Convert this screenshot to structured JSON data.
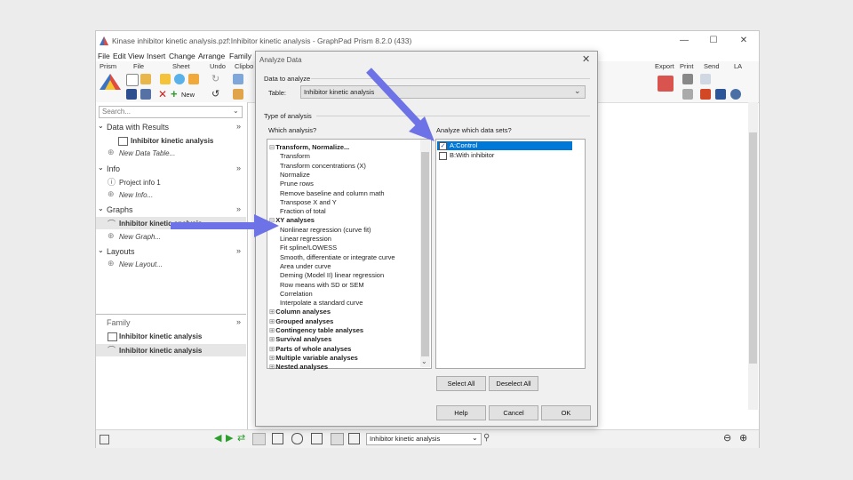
{
  "window": {
    "title": "Kinase inhibitor kinetic analysis.pzf:Inhibitor kinetic analysis - GraphPad Prism 8.2.0 (433)",
    "controls": [
      "—",
      "☐",
      "✕"
    ]
  },
  "menu": [
    "File",
    "Edit",
    "View",
    "Insert",
    "Change",
    "Arrange",
    "Family"
  ],
  "ribbon": {
    "groups_left": [
      "Prism",
      "File",
      "Sheet",
      "Undo",
      "Clipbo"
    ],
    "groups_right": [
      "Export",
      "Print",
      "Send",
      "LA"
    ],
    "new_label": "New"
  },
  "nav": {
    "search_placeholder": "Search...",
    "data_with_results": "Data with Results",
    "data_item": "Inhibitor kinetic analysis",
    "new_data_table": "New Data Table...",
    "info": "Info",
    "project_info": "Project info 1",
    "new_info": "New Info...",
    "graphs": "Graphs",
    "graph_item": "Inhibitor kinetic analysis",
    "new_graph": "New Graph...",
    "layouts": "Layouts",
    "new_layout": "New Layout...",
    "family": "Family",
    "family_items": [
      "Inhibitor kinetic analysis",
      "Inhibitor kinetic analysis"
    ]
  },
  "status": {
    "sheet_select": "Inhibitor kinetic analysis"
  },
  "dialog": {
    "title": "Analyze Data",
    "data_to_analyze": "Data to analyze",
    "table_label": "Table:",
    "table_value": "Inhibitor kinetic analysis",
    "type_of_analysis": "Type of analysis",
    "which_analysis": "Which analysis?",
    "analyze_which": "Analyze which data sets?",
    "analyses": [
      {
        "text": "Transform, Normalize...",
        "group": true,
        "open": true
      },
      {
        "text": "Transform"
      },
      {
        "text": "Transform concentrations (X)"
      },
      {
        "text": "Normalize"
      },
      {
        "text": "Prune rows"
      },
      {
        "text": "Remove baseline and column math"
      },
      {
        "text": "Transpose X and Y"
      },
      {
        "text": "Fraction of total"
      },
      {
        "text": "XY analyses",
        "group": true,
        "open": true
      },
      {
        "text": "Nonlinear regression (curve fit)"
      },
      {
        "text": "Linear regression"
      },
      {
        "text": "Fit spline/LOWESS"
      },
      {
        "text": "Smooth, differentiate or integrate curve"
      },
      {
        "text": "Area under curve"
      },
      {
        "text": "Deming (Model II) linear regression"
      },
      {
        "text": "Row means with SD or SEM"
      },
      {
        "text": "Correlation"
      },
      {
        "text": "Interpolate a standard curve"
      },
      {
        "text": "Column analyses",
        "group": true
      },
      {
        "text": "Grouped analyses",
        "group": true
      },
      {
        "text": "Contingency table analyses",
        "group": true
      },
      {
        "text": "Survival analyses",
        "group": true
      },
      {
        "text": "Parts of whole analyses",
        "group": true
      },
      {
        "text": "Multiple variable analyses",
        "group": true
      },
      {
        "text": "Nested analyses",
        "group": true
      }
    ],
    "datasets": [
      {
        "text": "A:Control",
        "checked": true,
        "selected": true
      },
      {
        "text": "B:With inhibitor",
        "checked": false,
        "selected": false
      }
    ],
    "select_all": "Select All",
    "deselect_all": "Deselect All",
    "help": "Help",
    "cancel": "Cancel",
    "ok": "OK"
  },
  "colors": {
    "selection": "#0078d7",
    "arrow": "#6d72e6",
    "dialog_bg": "#f0f0f0"
  }
}
